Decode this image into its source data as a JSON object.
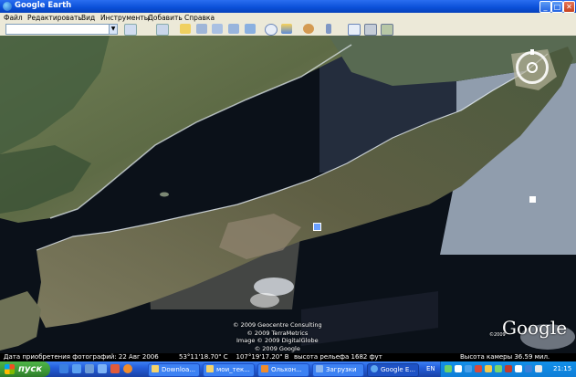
{
  "window": {
    "title": "Google Earth",
    "minimize": "_",
    "maximize": "□",
    "close": "✕"
  },
  "menu": [
    "Файл",
    "Редактировать",
    "Вид",
    "Инструменты",
    "Добавить",
    "Справка"
  ],
  "toolbar": {
    "search_value": "",
    "icons": [
      "search-icon",
      "sidebar-icon",
      "placemark-icon",
      "polygon-icon",
      "path-icon",
      "overlay-icon",
      "tour-icon",
      "history-icon",
      "sun-icon",
      "planet-icon",
      "ruler-icon",
      "email-icon",
      "print-icon",
      "map-icon"
    ]
  },
  "map": {
    "credits": [
      "© 2009 Geocentre Consulting",
      "© 2009 TerraMetrics",
      "Image © 2009 DigitalGlobe",
      "© 2009 Google"
    ],
    "logo": "Google",
    "logo_year": "©2009"
  },
  "status": {
    "imagery_date": "Дата приобретения фотографий: 22 Авг 2006",
    "coords": "53°11'18.70\" С    107°19'17.20\" В",
    "elevation": "высота рельефа  1682 фут",
    "eye_alt": "Высота камеры   36.59 мил."
  },
  "taskbar": {
    "start": "пуск",
    "tasks": [
      "Downloa...",
      "мои_тек...",
      "Ольхон...",
      "Загрузки",
      "Google E..."
    ],
    "language": "EN",
    "time": "21:15"
  },
  "colors": {
    "titlebar": "#0a4fd8",
    "taskbar": "#245edb",
    "start": "#3c9a36",
    "tray": "#0f7fd8"
  }
}
